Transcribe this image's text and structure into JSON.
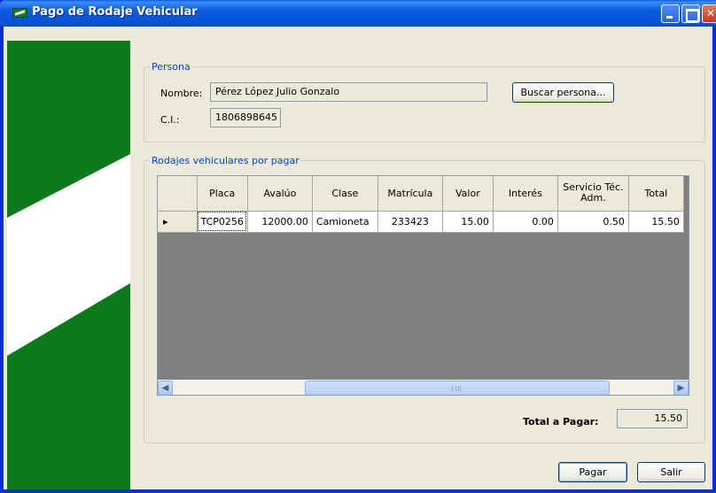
{
  "window": {
    "title": "Pago de Rodaje Vehicular"
  },
  "persona": {
    "legend": "Persona",
    "nombre_label": "Nombre:",
    "nombre_value": "Pérez López Julio Gonzalo",
    "ci_label": "C.I.:",
    "ci_value": "1806898645",
    "buscar_label": "Buscar persona..."
  },
  "rodajes": {
    "legend": "Rodajes vehiculares por pagar",
    "columns": [
      "Placa",
      "Avalúo",
      "Clase",
      "Matrícula",
      "Valor",
      "Interés",
      "Servicio Téc. Adm.",
      "Total"
    ],
    "rows": [
      {
        "indicator": "▸",
        "placa": "TCP0256",
        "avaluo": "12000.00",
        "clase": "Camioneta",
        "matricula": "233423",
        "valor": "15.00",
        "interes": "0.00",
        "servicio": "0.50",
        "total": "15.50"
      }
    ],
    "total_label": "Total a Pagar:",
    "total_value": "15.50"
  },
  "buttons": {
    "pagar": "Pagar",
    "salir": "Salir"
  },
  "icons": {
    "app": "flag-icon",
    "minimize": "minimize-icon",
    "maximize": "maximize-icon",
    "close": "close-icon",
    "row_indicator": "row-pointer-icon",
    "scroll_left": "arrow-left-icon",
    "scroll_right": "arrow-right-icon"
  },
  "colors": {
    "flag_green": "#0a7a1a",
    "title_blue": "#0553d6",
    "legend_blue": "#0046d5"
  }
}
